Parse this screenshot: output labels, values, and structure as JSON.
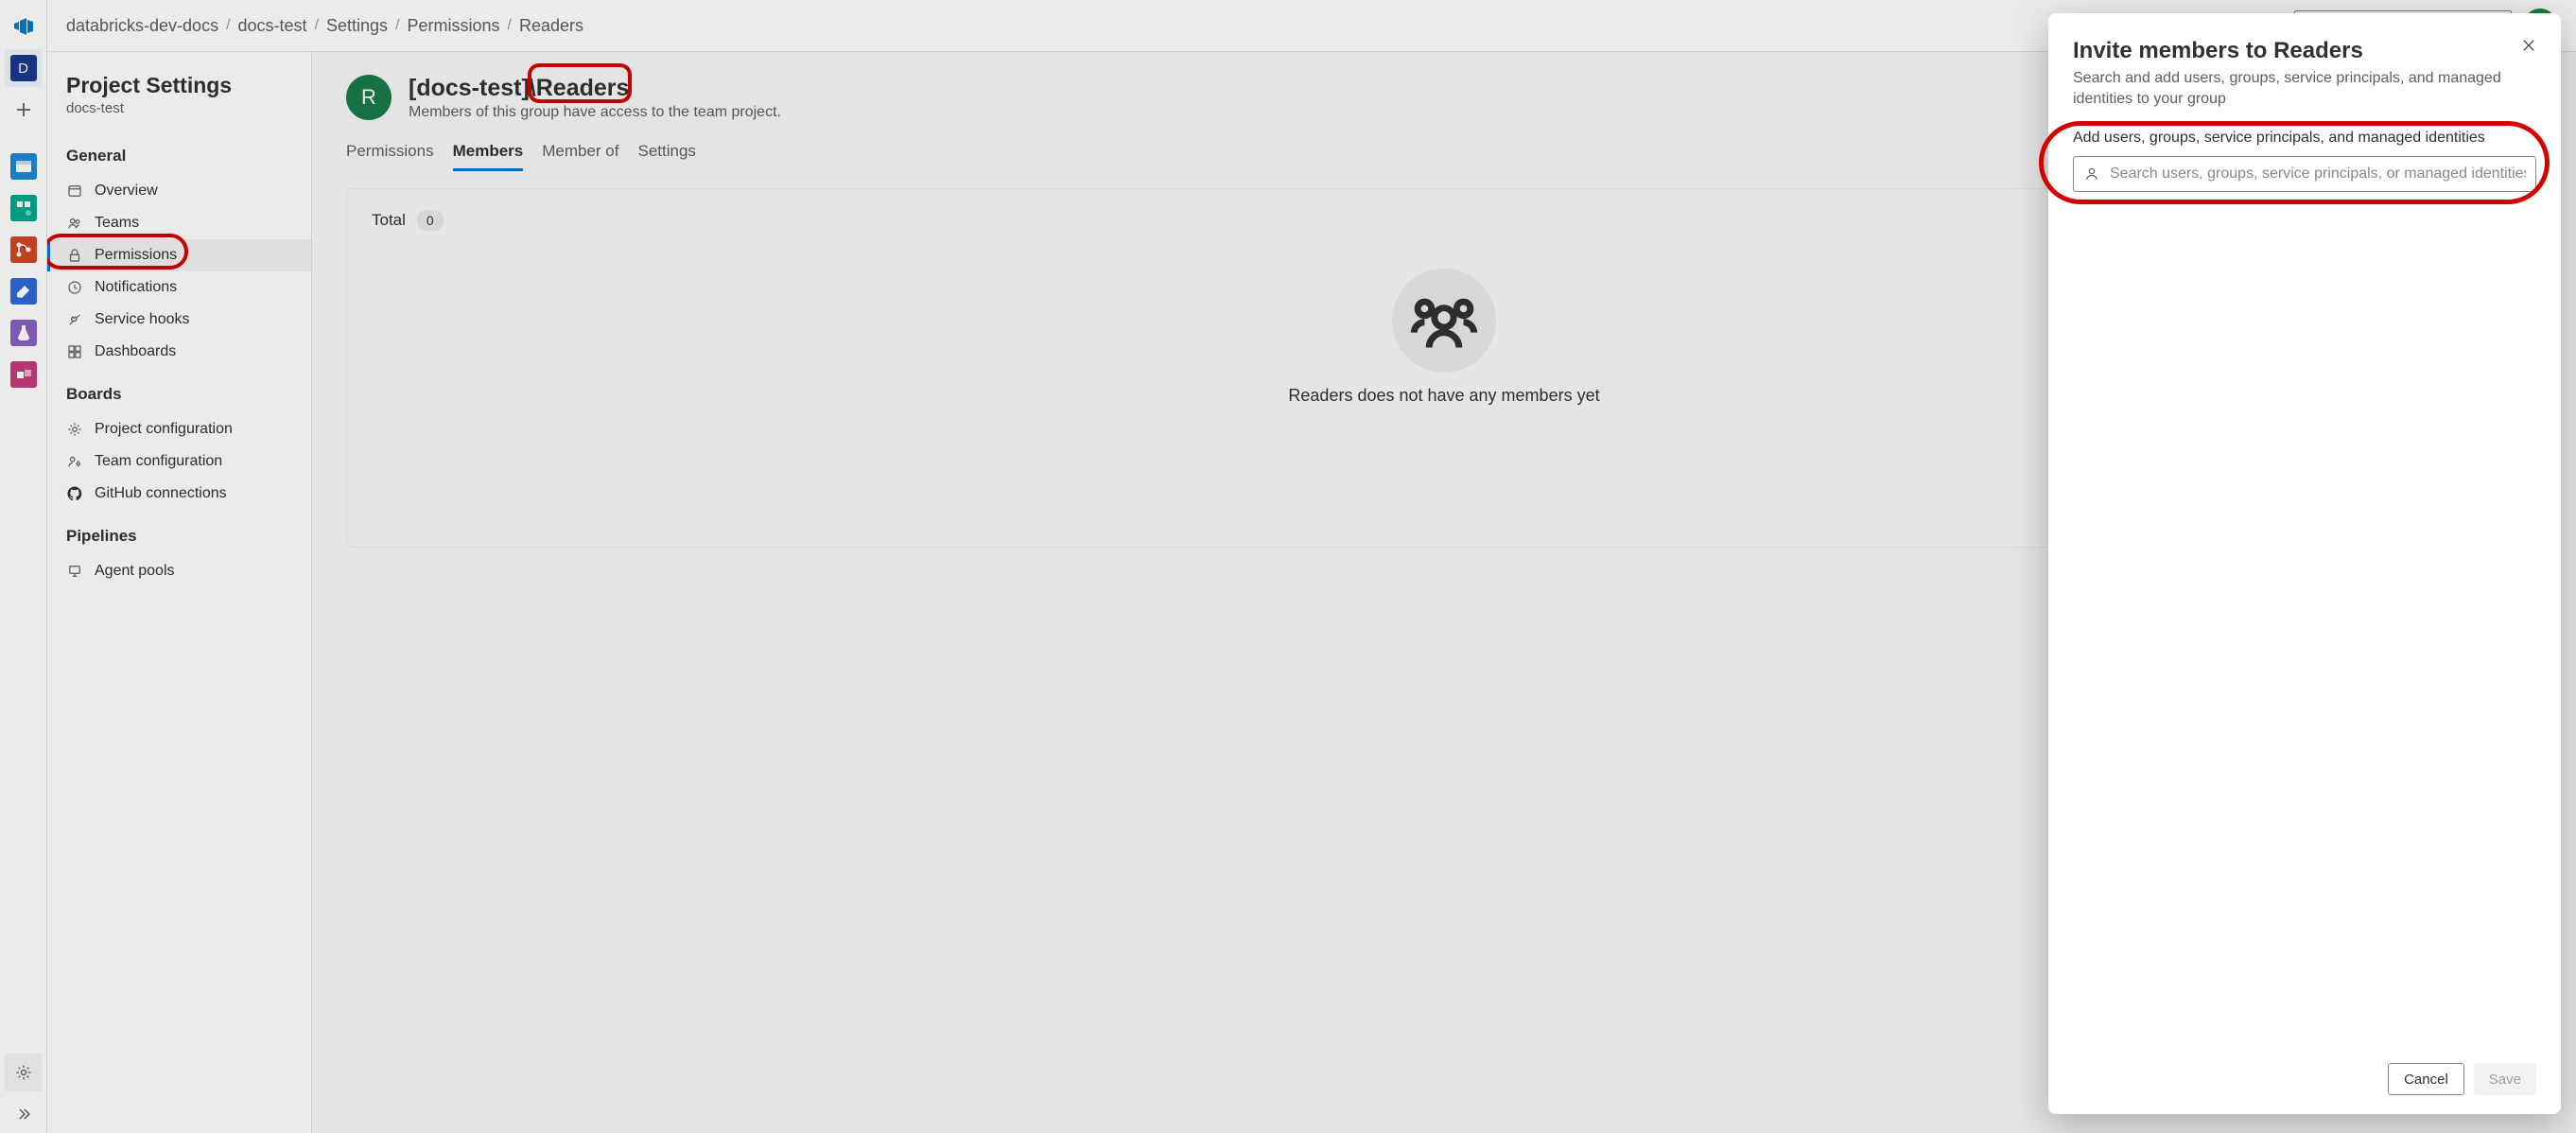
{
  "breadcrumb": [
    "databricks-dev-docs",
    "docs-test",
    "Settings",
    "Permissions",
    "Readers"
  ],
  "rail": {
    "project_initial": "D",
    "icons": [
      "overview-icon",
      "boards-icon",
      "repos-icon",
      "pipelines-icon",
      "test-plans-icon",
      "artifacts-icon"
    ]
  },
  "sidebar": {
    "title": "Project Settings",
    "subtitle": "docs-test",
    "sections": [
      {
        "heading": "General",
        "items": [
          {
            "label": "Overview",
            "icon": "card-icon"
          },
          {
            "label": "Teams",
            "icon": "people-icon"
          },
          {
            "label": "Permissions",
            "icon": "lock-icon",
            "selected": true
          },
          {
            "label": "Notifications",
            "icon": "bell-icon"
          },
          {
            "label": "Service hooks",
            "icon": "plug-icon"
          },
          {
            "label": "Dashboards",
            "icon": "dashboard-icon"
          }
        ]
      },
      {
        "heading": "Boards",
        "items": [
          {
            "label": "Project configuration",
            "icon": "gear-icon"
          },
          {
            "label": "Team configuration",
            "icon": "team-gear-icon"
          },
          {
            "label": "GitHub connections",
            "icon": "github-icon"
          }
        ]
      },
      {
        "heading": "Pipelines",
        "items": [
          {
            "label": "Agent pools",
            "icon": "agent-icon"
          }
        ]
      }
    ]
  },
  "group": {
    "avatar_initial": "R",
    "prefix": "[docs-test]\\",
    "name": "Readers",
    "description": "Members of this group have access to the team project."
  },
  "tabs": [
    "Permissions",
    "Members",
    "Member of",
    "Settings"
  ],
  "active_tab": "Members",
  "members": {
    "total_label": "Total",
    "total_count": "0",
    "empty_text": "Readers does not have any members yet"
  },
  "dialog": {
    "title": "Invite members to Readers",
    "subtitle": "Search and add users, groups, service principals, and managed identities to your group",
    "field_label": "Add users, groups, service principals, and managed identities",
    "placeholder": "Search users, groups, service principals, or managed identities",
    "cancel": "Cancel",
    "save": "Save"
  }
}
